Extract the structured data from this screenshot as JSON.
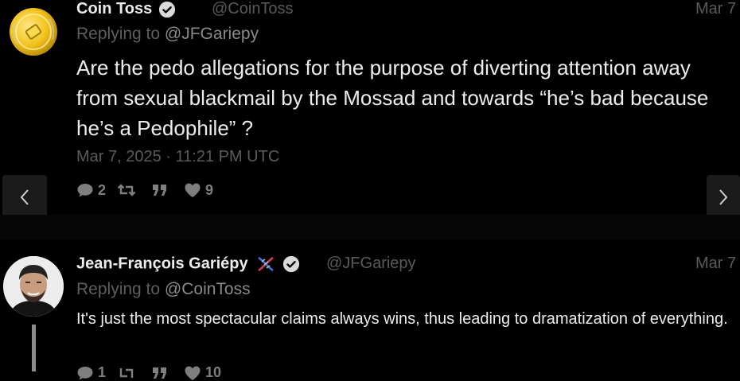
{
  "post1": {
    "author_name": "Coin Toss",
    "handle": "@CoinToss",
    "date_short": "Mar 7",
    "replying_prefix": "Replying to ",
    "replying_to": "@JFGariepy",
    "content": "Are the pedo allegations for the purpose of diverting attention away from sexual blackmail by the Mossad and towards “he’s bad because he’s a Pedophile” ?",
    "full_date": "Mar 7, 2025 · 11:21 PM UTC",
    "stats": {
      "comments": "2",
      "retweets": "",
      "quotes": "",
      "likes": "9"
    }
  },
  "post2": {
    "author_name": "Jean-François Gariépy",
    "handle": "@JFGariepy",
    "date_short": "Mar 7",
    "replying_prefix": "Replying to ",
    "replying_to": "@CoinToss",
    "content": "It's just the most spectacular claims always wins, thus leading to dramatization of everything.",
    "stats": {
      "comments": "1",
      "retweets": "",
      "quotes": "",
      "likes": "10"
    }
  },
  "colors": {
    "background": "#000000",
    "text": "#ececec",
    "muted": "#5a5a5a",
    "icons": "#7e7e7e",
    "verified": "#d9d9d9"
  }
}
